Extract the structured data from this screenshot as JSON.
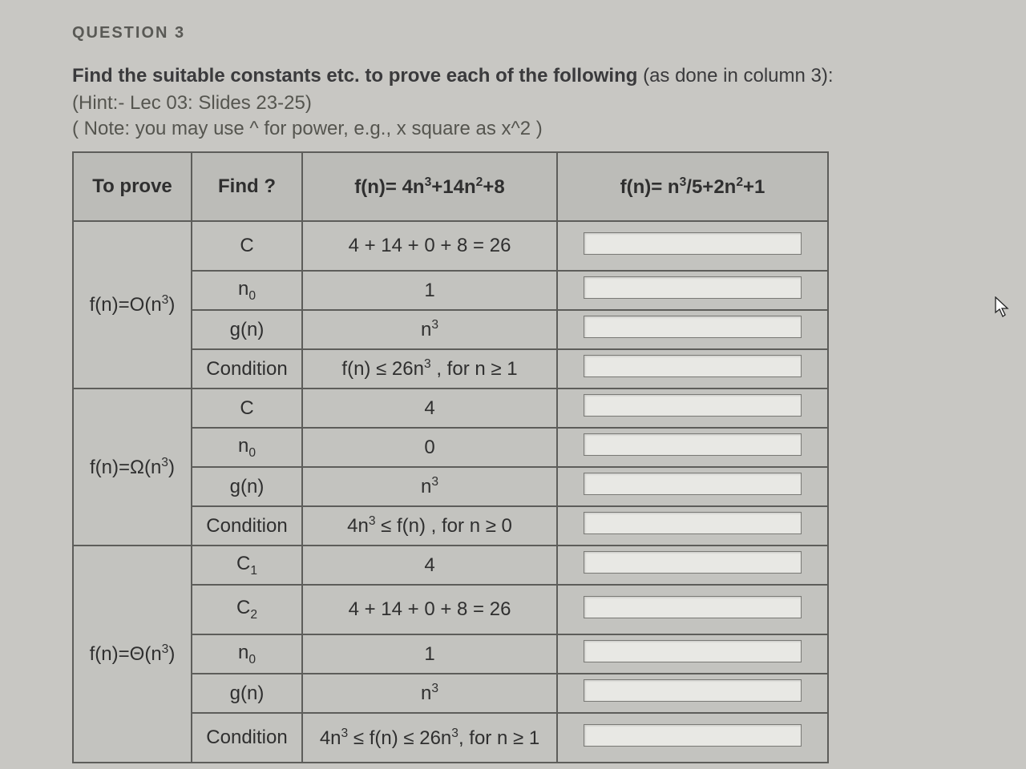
{
  "question_number": "QUESTION 3",
  "prompt_bold": "Find the suitable constants etc. to prove each of the following",
  "prompt_rest": " (as done in column 3):",
  "hint": "(Hint:- Lec 03: Slides 23-25)",
  "note": "( Note: you may use ^ for power, e.g., x square as x^2 )",
  "headers": {
    "to_prove": "To prove",
    "find": "Find ?",
    "f1_html": "f(n)= 4n<sup>3</sup>+14n<sup>2</sup>+8",
    "f2_html": "f(n)= n<sup>3</sup>/5+2n<sup>2</sup>+1"
  },
  "groups": [
    {
      "prove_html": "f(n)=O(n<sup>3</sup>)",
      "rows": [
        {
          "find": "C",
          "f1_html": "4 + 14 + 0 + 8 = 26",
          "answer": "",
          "tall": true
        },
        {
          "find_html": "n<sub>0</sub>",
          "f1_html": "1",
          "answer": ""
        },
        {
          "find": "g(n)",
          "f1_html": "n<sup>3</sup>",
          "answer": ""
        },
        {
          "find": "Condition",
          "f1_html": "f(n) ≤ 26n<sup>3</sup> , for n ≥ 1",
          "answer": ""
        }
      ]
    },
    {
      "prove_html": "f(n)=Ω(n<sup>3</sup>)",
      "rows": [
        {
          "find": "C",
          "f1_html": "4",
          "answer": ""
        },
        {
          "find_html": "n<sub>0</sub>",
          "f1_html": "0",
          "answer": ""
        },
        {
          "find": "g(n)",
          "f1_html": "n<sup>3</sup>",
          "answer": ""
        },
        {
          "find": "Condition",
          "f1_html": "4n<sup>3</sup> ≤ f(n) , for n ≥ 0",
          "answer": ""
        }
      ]
    },
    {
      "prove_html": "f(n)=Θ(n<sup>3</sup>)",
      "rows": [
        {
          "find_html": "C<sub>1</sub>",
          "f1_html": "4",
          "answer": ""
        },
        {
          "find_html": "C<sub>2</sub>",
          "f1_html": "4 + 14 + 0 + 8 = 26",
          "answer": "",
          "tall": true
        },
        {
          "find_html": "n<sub>0</sub>",
          "f1_html": "1",
          "answer": ""
        },
        {
          "find": "g(n)",
          "f1_html": "n<sup>3</sup>",
          "answer": ""
        },
        {
          "find": "Condition",
          "f1_html": "4n<sup>3</sup> ≤ f(n) ≤ 26n<sup>3</sup>, for n ≥ 1",
          "answer": "",
          "tall": true
        }
      ]
    }
  ]
}
